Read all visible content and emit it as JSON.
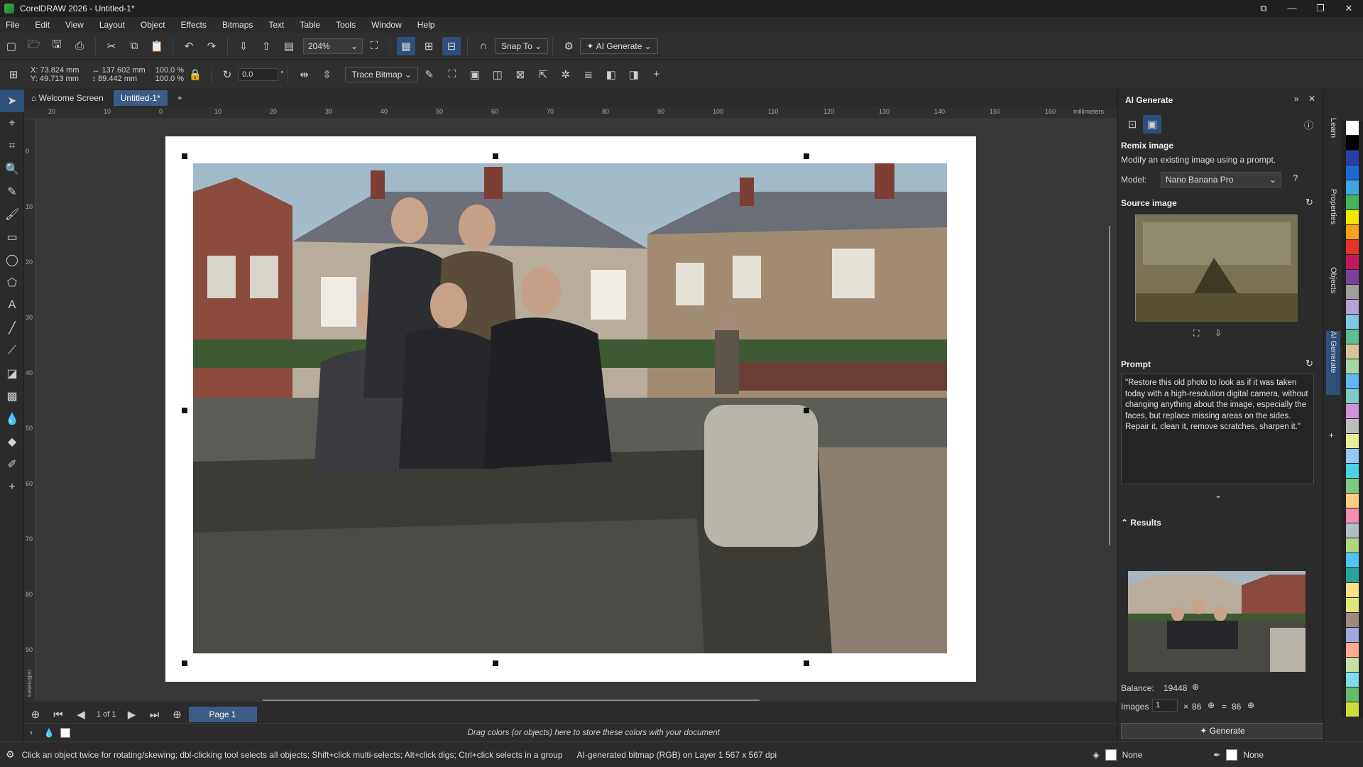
{
  "window": {
    "title": "CorelDRAW 2026 - Untitled-1*",
    "controls": [
      "⧉",
      "—",
      "❐",
      "✕"
    ]
  },
  "menu": [
    "File",
    "Edit",
    "View",
    "Layout",
    "Object",
    "Effects",
    "Bitmaps",
    "Text",
    "Table",
    "Tools",
    "Window",
    "Help"
  ],
  "toolbar1": {
    "zoom": "204%",
    "snap_to": "Snap To",
    "ai_generate": "AI Generate"
  },
  "toolbar2": {
    "x": "X: 73.824 mm",
    "y": "Y: 49.713 mm",
    "width": "137.602 mm",
    "height": "89.442 mm",
    "scale_w": "100.0",
    "scale_h": "100.0",
    "pct": "%",
    "rotation": "0.0",
    "deg": "°",
    "trace_bitmap": "Trace Bitmap"
  },
  "doc_tabs": {
    "welcome": "Welcome Screen",
    "active": "Untitled-1*"
  },
  "ruler": {
    "unit": "millimeters",
    "h_ticks": [
      "20",
      "10",
      "0",
      "10",
      "20",
      "30",
      "40",
      "50",
      "60",
      "70",
      "80",
      "90",
      "100",
      "110",
      "120",
      "130",
      "140",
      "150",
      "160"
    ],
    "v_ticks": [
      "0",
      "10",
      "20",
      "30",
      "40",
      "50",
      "60",
      "70",
      "80",
      "90"
    ],
    "v_unit": "millimeters"
  },
  "page_nav": {
    "counter": "1 of 1",
    "page_tab": "Page 1"
  },
  "color_bar": {
    "hint": "Drag colors (or objects) here to store these colors with your document"
  },
  "status": {
    "hint": "Click an object twice for rotating/skewing; dbl-clicking tool selects all objects; Shift+click multi-selects; Alt+click digs; Ctrl+click selects in a group",
    "info": "AI-generated bitmap (RGB) on Layer 1  567 x 567 dpi",
    "fill": "None",
    "outline": "None"
  },
  "panel": {
    "title": "AI Generate",
    "remix_title": "Remix image",
    "remix_desc": "Modify an existing image using a prompt.",
    "model_label": "Model:",
    "model_value": "Nano Banana Pro",
    "source_image": "Source image",
    "prompt_label": "Prompt",
    "prompt_text": "\"Restore this old photo to look as if it was taken today with a high-resolution digital camera, without changing anything about the image, especially the faces, but replace missing areas on the sides. Repair it, clean it, remove scratches, sharpen it.\"",
    "results_label": "Results",
    "balance_label": "Balance:",
    "balance_value": "19448",
    "images_label": "Images",
    "images_value": "1",
    "times": "×",
    "credits_per": "86",
    "equals": "=",
    "credits_total": "86",
    "generate": "Generate"
  },
  "dockers": [
    "Learn",
    "Properties",
    "Objects",
    "AI Generate"
  ],
  "palette_colors": [
    "#ffffff",
    "#000000",
    "#2a3ea8",
    "#1b6ad8",
    "#3fa7e0",
    "#46b35a",
    "#f2e600",
    "#f7a11b",
    "#e5332a",
    "#c2185b",
    "#7b3fa0",
    "#9e9e9e",
    "#b9a0d6",
    "#7ec8e3",
    "#5bbf8f",
    "#d7c59a",
    "#a5d6a7",
    "#64b5f6",
    "#80cbc4",
    "#ce93d8",
    "#bdbdbd",
    "#e6ee9c",
    "#90caf9",
    "#4dd0e1",
    "#81c784",
    "#ffcc80",
    "#f48fb1",
    "#b0bec5",
    "#aed581",
    "#4fc3f7",
    "#26a69a",
    "#ffe082",
    "#dce775",
    "#a1887f",
    "#9fa8da",
    "#ffab91",
    "#c5e1a5",
    "#80deea",
    "#66bb6a",
    "#cddc39"
  ],
  "colors": {
    "accent": "#2d4f7a",
    "page_tab": "#3b5c85",
    "background": "#2b2b2b"
  }
}
